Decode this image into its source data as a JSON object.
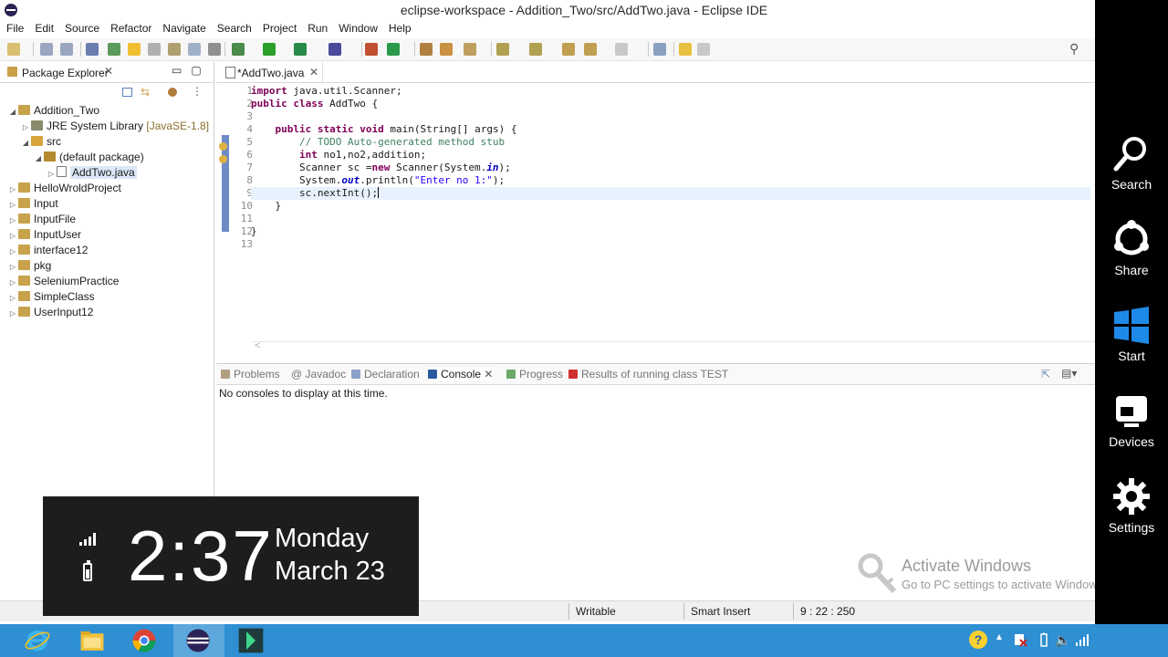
{
  "window": {
    "title": "eclipse-workspace - Addition_Two/src/AddTwo.java - Eclipse IDE"
  },
  "menu": [
    "File",
    "Edit",
    "Source",
    "Refactor",
    "Navigate",
    "Search",
    "Project",
    "Run",
    "Window",
    "Help"
  ],
  "package_explorer": {
    "tab_label": "Package Explorer",
    "tree": [
      {
        "label": "Addition_Two",
        "extra": "",
        "indent": 0,
        "expanded": true,
        "type": "project"
      },
      {
        "label": "JRE System Library",
        "extra": " [JavaSE-1.8]",
        "indent": 1,
        "expanded": false,
        "type": "lib"
      },
      {
        "label": "src",
        "extra": "",
        "indent": 1,
        "expanded": true,
        "type": "src"
      },
      {
        "label": "(default package)",
        "extra": "",
        "indent": 2,
        "expanded": true,
        "type": "package"
      },
      {
        "label": "AddTwo.java",
        "extra": "",
        "indent": 3,
        "expanded": false,
        "type": "file"
      },
      {
        "label": "HelloWroldProject",
        "extra": "",
        "indent": 0,
        "expanded": false,
        "type": "project"
      },
      {
        "label": "Input",
        "extra": "",
        "indent": 0,
        "expanded": false,
        "type": "project"
      },
      {
        "label": "InputFile",
        "extra": "",
        "indent": 0,
        "expanded": false,
        "type": "project"
      },
      {
        "label": "InputUser",
        "extra": "",
        "indent": 0,
        "expanded": false,
        "type": "project"
      },
      {
        "label": "interface12",
        "extra": "",
        "indent": 0,
        "expanded": false,
        "type": "project"
      },
      {
        "label": "pkg",
        "extra": "",
        "indent": 0,
        "expanded": false,
        "type": "project"
      },
      {
        "label": "SeleniumPractice",
        "extra": "",
        "indent": 0,
        "expanded": false,
        "type": "project"
      },
      {
        "label": "SimpleClass",
        "extra": "",
        "indent": 0,
        "expanded": false,
        "type": "project"
      },
      {
        "label": "UserInput12",
        "extra": "",
        "indent": 0,
        "expanded": false,
        "type": "project"
      }
    ]
  },
  "editor": {
    "tab_label": "*AddTwo.java",
    "line_numbers": [
      "1",
      "2",
      "3",
      "4",
      "5",
      "6",
      "7",
      "8",
      "9",
      "10",
      "11",
      "12",
      "13"
    ],
    "code": [
      [
        {
          "t": "import",
          "c": "kw"
        },
        {
          "t": " java.util.Scanner;",
          "c": ""
        }
      ],
      [
        {
          "t": "public",
          "c": "kw"
        },
        {
          "t": " ",
          "c": ""
        },
        {
          "t": "class",
          "c": "kw"
        },
        {
          "t": " AddTwo {",
          "c": ""
        }
      ],
      [],
      [
        {
          "t": "    ",
          "c": ""
        },
        {
          "t": "public",
          "c": "kw"
        },
        {
          "t": " ",
          "c": ""
        },
        {
          "t": "static",
          "c": "kw"
        },
        {
          "t": " ",
          "c": ""
        },
        {
          "t": "void",
          "c": "kw"
        },
        {
          "t": " main(String[] args) {",
          "c": ""
        }
      ],
      [
        {
          "t": "        ",
          "c": ""
        },
        {
          "t": "// TODO Auto-generated method stub",
          "c": "cm"
        }
      ],
      [
        {
          "t": "        ",
          "c": ""
        },
        {
          "t": "int",
          "c": "kw"
        },
        {
          "t": " no1,no2,addition;",
          "c": ""
        }
      ],
      [
        {
          "t": "        Scanner sc =",
          "c": ""
        },
        {
          "t": "new",
          "c": "kw"
        },
        {
          "t": " Scanner(System.",
          "c": ""
        },
        {
          "t": "in",
          "c": "it"
        },
        {
          "t": ");",
          "c": ""
        }
      ],
      [
        {
          "t": "        System.",
          "c": ""
        },
        {
          "t": "out",
          "c": "it"
        },
        {
          "t": ".println(",
          "c": ""
        },
        {
          "t": "\"Enter no 1:\"",
          "c": "st"
        },
        {
          "t": ");",
          "c": ""
        }
      ],
      [
        {
          "t": "        sc.nextInt();",
          "c": ""
        }
      ],
      [
        {
          "t": "    }",
          "c": ""
        }
      ],
      [],
      [
        {
          "t": "}",
          "c": ""
        }
      ],
      []
    ],
    "current_line": 9
  },
  "bottom_panel": {
    "tabs": [
      {
        "label": "Problems",
        "active": false,
        "color": "#b0a080"
      },
      {
        "label": "@ Javadoc",
        "active": false,
        "color": ""
      },
      {
        "label": "Declaration",
        "active": false,
        "color": "#8aa0c8"
      },
      {
        "label": "Console",
        "active": true,
        "color": "#2c5aa0"
      },
      {
        "label": "Progress",
        "active": false,
        "color": "#6aa86a"
      },
      {
        "label": "Results of running class TEST",
        "active": false,
        "color": "#d03030"
      }
    ],
    "console_message": "No consoles to display at this time."
  },
  "status_bar": {
    "writable": "Writable",
    "insert_mode": "Smart Insert",
    "position": "9 : 22 : 250"
  },
  "watermark": {
    "line1": "Activate Windows",
    "line2": "Go to PC settings to activate Windows."
  },
  "charms": [
    {
      "label": "Search",
      "icon": "search-icon"
    },
    {
      "label": "Share",
      "icon": "share-icon"
    },
    {
      "label": "Start",
      "icon": "windows-logo-icon"
    },
    {
      "label": "Devices",
      "icon": "devices-icon"
    },
    {
      "label": "Settings",
      "icon": "gear-icon"
    }
  ],
  "clock": {
    "time": "2:37",
    "day": "Monday",
    "date": "March 23"
  },
  "taskbar": {
    "apps": [
      {
        "name": "internet-explorer",
        "active": false
      },
      {
        "name": "file-explorer",
        "active": false
      },
      {
        "name": "chrome",
        "active": false
      },
      {
        "name": "eclipse",
        "active": true
      },
      {
        "name": "app-green",
        "active": false
      }
    ]
  }
}
